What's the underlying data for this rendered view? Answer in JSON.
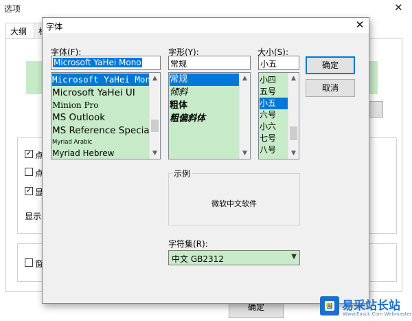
{
  "background_window": {
    "title": "选项",
    "close_glyph": "✕",
    "tabs": [
      "大纲",
      "标"
    ],
    "check_items": [
      {
        "label": "点",
        "checked": true
      },
      {
        "label": "点",
        "checked": false
      },
      {
        "label": "显",
        "checked": true
      }
    ],
    "side_text": "显示关",
    "window_check": {
      "label": "窗",
      "checked": false
    },
    "ok_button": "确定"
  },
  "dialog": {
    "title": "字体",
    "close_glyph": "✕",
    "font_label": "字体(F):",
    "font_value": "Microsoft YaHei Mono",
    "font_list": [
      "Microsoft YaHei Mono",
      "Microsoft YaHei UI",
      "Minion Pro",
      "MS Outlook",
      "MS Reference Specialty",
      "Myriad Arabic",
      "Myriad Hebrew"
    ],
    "font_selected_index": 0,
    "style_label": "字形(Y):",
    "style_value": "常规",
    "style_list": [
      "常规",
      "倾斜",
      "粗体",
      "粗偏斜体"
    ],
    "style_selected_index": 0,
    "size_label": "大小(S):",
    "size_value": "小五",
    "size_list": [
      "小四",
      "五号",
      "小五",
      "六号",
      "小六",
      "七号",
      "八号"
    ],
    "size_selected_index": 2,
    "ok_button": "确定",
    "cancel_button": "取消",
    "sample_label": "示例",
    "sample_text": "微软中文软件",
    "charset_label": "字符集(R):",
    "charset_value": "中文 GB2312",
    "colors": {
      "list_bg": "#c7ebc8",
      "selection": "#0078d7"
    }
  },
  "watermark": {
    "text_cn": "易采站长站",
    "text_en": "Www.Easck.Com Webmaster"
  }
}
